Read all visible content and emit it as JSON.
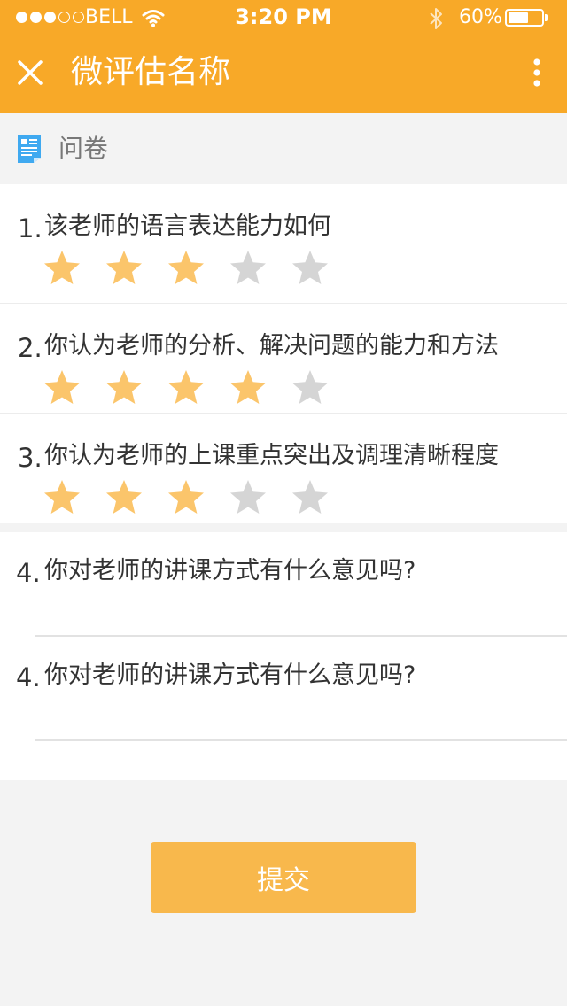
{
  "status_bar": {
    "signal_filled": 3,
    "signal_total": 5,
    "carrier": "BELL",
    "time": "3:20 PM",
    "battery_text": "60%",
    "battery_level": 0.6,
    "icons": [
      "signal-icon",
      "wifi-icon",
      "bluetooth-icon",
      "battery-icon"
    ]
  },
  "nav": {
    "title": "微评估名称",
    "left_icon": "close-icon",
    "right_icon": "more-vertical-icon"
  },
  "section": {
    "title": "问卷",
    "icon": "document-icon"
  },
  "rating_questions": [
    {
      "number": "1.",
      "text": "该老师的语言表达能力如何",
      "rating": 3,
      "max": 5
    },
    {
      "number": "2.",
      "text": "你认为老师的分析、解决问题的能力和方法",
      "rating": 4,
      "max": 5
    },
    {
      "number": "3.",
      "text": "你认为老师的上课重点突出及调理清晰程度",
      "rating": 3,
      "max": 5
    }
  ],
  "open_questions": [
    {
      "number": "4.",
      "text": "你对老师的讲课方式有什么意见吗?",
      "value": ""
    },
    {
      "number": "4.",
      "text": "你对老师的讲课方式有什么意见吗?",
      "value": ""
    }
  ],
  "submit_label": "提交",
  "colors": {
    "brand": "#f8a928",
    "star_filled": "#fbc56b",
    "star_empty": "#d5d5d5",
    "submit": "#f8b84c",
    "background": "#f3f3f3"
  }
}
